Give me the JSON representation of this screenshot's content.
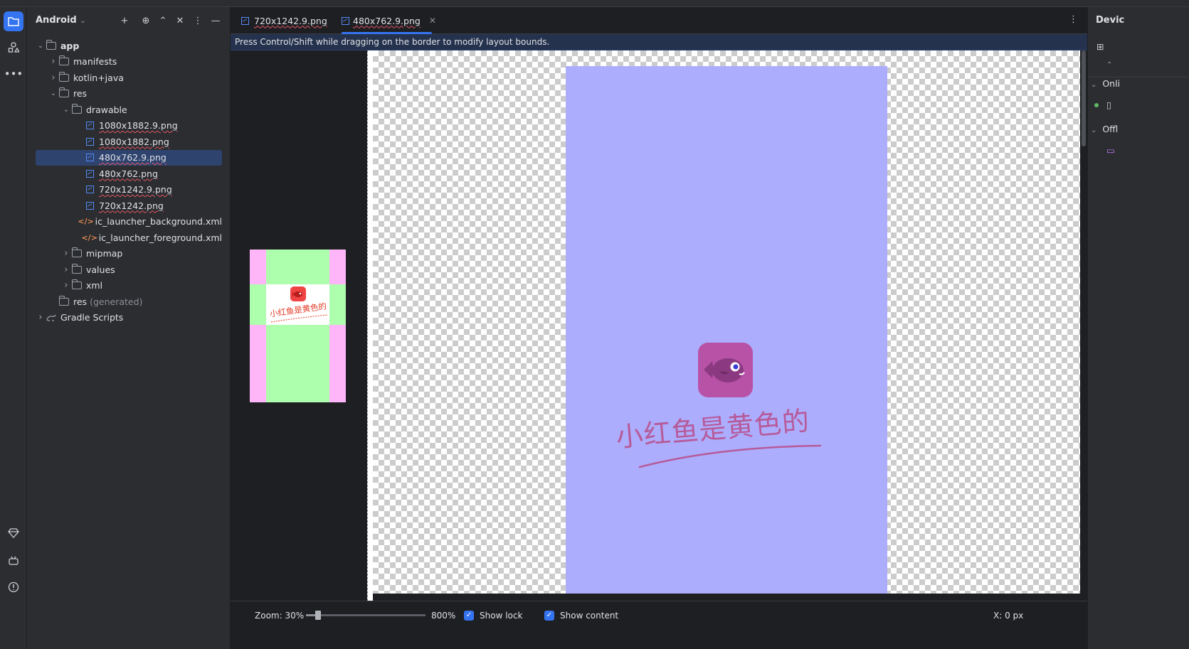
{
  "project_panel": {
    "title": "Android",
    "tree": [
      {
        "label": "app",
        "depth": 0,
        "expanded": true,
        "kind": "module"
      },
      {
        "label": "manifests",
        "depth": 1,
        "expanded": false,
        "kind": "folder"
      },
      {
        "label": "kotlin+java",
        "depth": 1,
        "expanded": false,
        "kind": "folder"
      },
      {
        "label": "res",
        "depth": 1,
        "expanded": true,
        "kind": "folder"
      },
      {
        "label": "drawable",
        "depth": 2,
        "expanded": true,
        "kind": "folder"
      },
      {
        "label": "1080x1882.9.png",
        "depth": 3,
        "kind": "image"
      },
      {
        "label": "1080x1882.png",
        "depth": 3,
        "kind": "image"
      },
      {
        "label": "480x762.9.png",
        "depth": 3,
        "kind": "image",
        "selected": true
      },
      {
        "label": "480x762.png",
        "depth": 3,
        "kind": "image"
      },
      {
        "label": "720x1242.9.png",
        "depth": 3,
        "kind": "image"
      },
      {
        "label": "720x1242.png",
        "depth": 3,
        "kind": "image"
      },
      {
        "label": "ic_launcher_background.xml",
        "depth": 3,
        "kind": "xml"
      },
      {
        "label": "ic_launcher_foreground.xml",
        "depth": 3,
        "kind": "xml"
      },
      {
        "label": "mipmap",
        "depth": 2,
        "expanded": false,
        "kind": "folder"
      },
      {
        "label": "values",
        "depth": 2,
        "expanded": false,
        "kind": "folder"
      },
      {
        "label": "xml",
        "depth": 2,
        "expanded": false,
        "kind": "folder"
      },
      {
        "label": "res",
        "suffix": "(generated)",
        "depth": 1,
        "kind": "folder"
      },
      {
        "label": "Gradle Scripts",
        "depth": 0,
        "expanded": false,
        "kind": "gradle"
      }
    ]
  },
  "tabs": [
    {
      "label": "720x1242.9.png",
      "active": false
    },
    {
      "label": "480x762.9.png",
      "active": true
    }
  ],
  "banner": "Press Control/Shift while dragging on the border to modify layout bounds.",
  "thumbnail_text": "小红鱼是黄色的",
  "canvas_text": "小红鱼是黄色的",
  "status": {
    "zoom_label": "Zoom: 30%",
    "zoom_max": "800%",
    "zoom_level": 0.1,
    "show_lock": "Show lock",
    "show_content": "Show content",
    "coords": "X: 0 px"
  },
  "right_panel": {
    "title": "Devic",
    "online": "Onli",
    "offline": "Offl"
  },
  "colors": {
    "accent": "#3574f0",
    "selection": "#2e436e",
    "patch_green": "#adfead",
    "patch_pink": "#ffb6f8",
    "image_bg": "#adadfe",
    "fish_tile": "#b852a7"
  }
}
